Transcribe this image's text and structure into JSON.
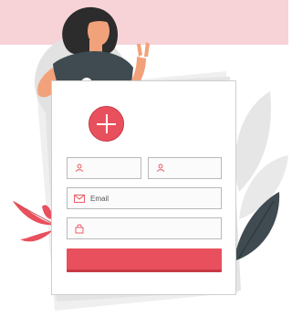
{
  "form": {
    "email_placeholder": "Email"
  },
  "icons": {
    "first_name": "user-icon",
    "last_name": "user-icon",
    "email": "envelope-icon",
    "password": "lock-icon",
    "add": "plus-icon",
    "avatar": "avatar-icon"
  },
  "colors": {
    "accent": "#e8505d",
    "band": "#f7d3d8",
    "shirt": "#3f4b51",
    "leaf_dark": "#3f4b51"
  }
}
